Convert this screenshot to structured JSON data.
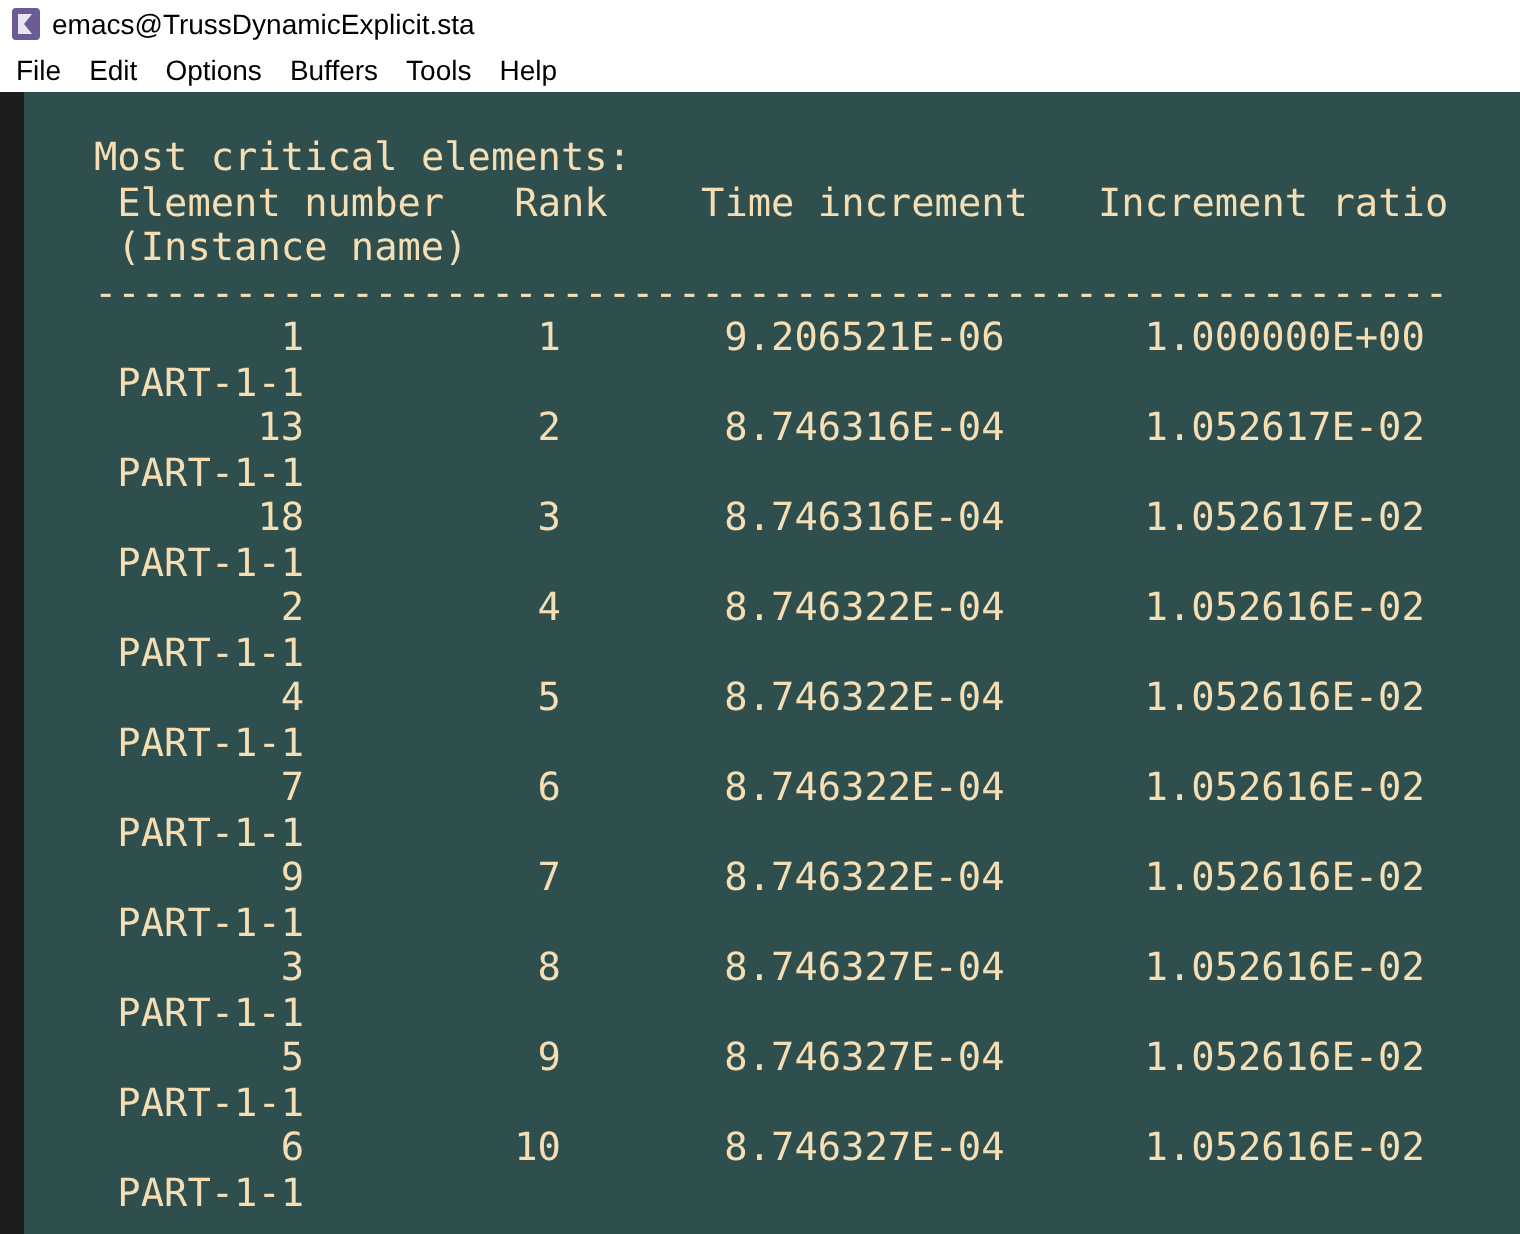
{
  "window": {
    "title": "emacs@TrussDynamicExplicit.sta"
  },
  "menu": [
    "File",
    "Edit",
    "Options",
    "Buffers",
    "Tools",
    "Help"
  ],
  "heading": "Most critical elements:",
  "columns": [
    {
      "label": "Element number",
      "sublabel": "(Instance name)"
    },
    {
      "label": "Rank"
    },
    {
      "label": "Time increment"
    },
    {
      "label": "Increment ratio"
    }
  ],
  "separator": "----------------------------------------------------------",
  "rows": [
    {
      "element_number": "1",
      "rank": "1",
      "time_increment": "9.206521E-06",
      "increment_ratio": "1.000000E+00",
      "instance_name": "PART-1-1"
    },
    {
      "element_number": "13",
      "rank": "2",
      "time_increment": "8.746316E-04",
      "increment_ratio": "1.052617E-02",
      "instance_name": "PART-1-1"
    },
    {
      "element_number": "18",
      "rank": "3",
      "time_increment": "8.746316E-04",
      "increment_ratio": "1.052617E-02",
      "instance_name": "PART-1-1"
    },
    {
      "element_number": "2",
      "rank": "4",
      "time_increment": "8.746322E-04",
      "increment_ratio": "1.052616E-02",
      "instance_name": "PART-1-1"
    },
    {
      "element_number": "4",
      "rank": "5",
      "time_increment": "8.746322E-04",
      "increment_ratio": "1.052616E-02",
      "instance_name": "PART-1-1"
    },
    {
      "element_number": "7",
      "rank": "6",
      "time_increment": "8.746322E-04",
      "increment_ratio": "1.052616E-02",
      "instance_name": "PART-1-1"
    },
    {
      "element_number": "9",
      "rank": "7",
      "time_increment": "8.746322E-04",
      "increment_ratio": "1.052616E-02",
      "instance_name": "PART-1-1"
    },
    {
      "element_number": "3",
      "rank": "8",
      "time_increment": "8.746327E-04",
      "increment_ratio": "1.052616E-02",
      "instance_name": "PART-1-1"
    },
    {
      "element_number": "5",
      "rank": "9",
      "time_increment": "8.746327E-04",
      "increment_ratio": "1.052616E-02",
      "instance_name": "PART-1-1"
    },
    {
      "element_number": "6",
      "rank": "10",
      "time_increment": "8.746327E-04",
      "increment_ratio": "1.052616E-02",
      "instance_name": "PART-1-1"
    }
  ]
}
